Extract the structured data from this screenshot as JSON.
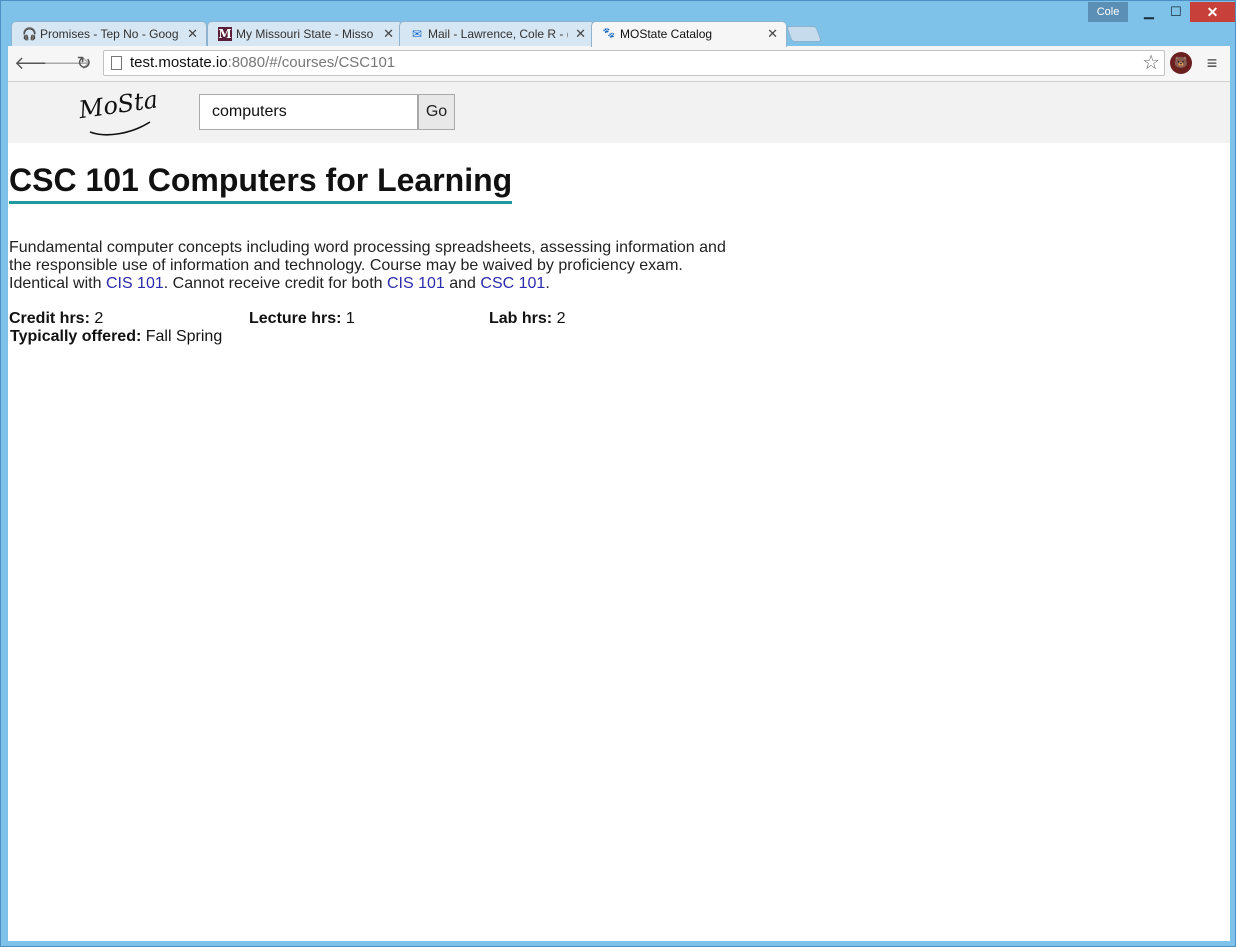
{
  "window": {
    "profile_name": "Cole",
    "minimize_glyph": "▁",
    "maximize_glyph": "☐",
    "close_glyph": "✕"
  },
  "tabs": [
    {
      "label": "Promises - Tep No - Goog",
      "icon": "headphones-icon",
      "icon_glyph": "🎧",
      "active": false
    },
    {
      "label": "My Missouri State - Misso",
      "icon": "m-logo-icon",
      "icon_glyph": "M",
      "active": false
    },
    {
      "label": "Mail - Lawrence, Cole R - (",
      "icon": "mail-icon",
      "icon_glyph": "✉",
      "active": false
    },
    {
      "label": "MOState Catalog",
      "icon": "bear-icon",
      "icon_glyph": "🐾",
      "active": true
    }
  ],
  "toolbar": {
    "url_host": "test.mostate.io",
    "url_path": ":8080/#/courses/CSC101"
  },
  "site": {
    "logo_text": "MoState",
    "search_value": "computers",
    "go_label": "Go"
  },
  "course": {
    "title": "CSC 101 Computers for Learning",
    "desc_part1": "Fundamental computer concepts including word processing spreadsheets, assessing information and the responsible use of information and technology. Course may be waived by proficiency exam. Identical with ",
    "link1": "CIS 101",
    "desc_part2": ". Cannot receive credit for both ",
    "link2": "CIS 101",
    "desc_part3": " and ",
    "link3": "CSC 101",
    "desc_part4": ".",
    "credit_label": "Credit hrs:",
    "credit_value": "2",
    "lecture_label": "Lecture hrs:",
    "lecture_value": "1",
    "lab_label": "Lab hrs:",
    "lab_value": "2",
    "offered_label": "Typically offered:",
    "offered_value": "Fall Spring"
  },
  "colors": {
    "title_underline": "#1e9aa0",
    "link": "#2b2bb0",
    "header_bg": "#f2f2f2"
  }
}
